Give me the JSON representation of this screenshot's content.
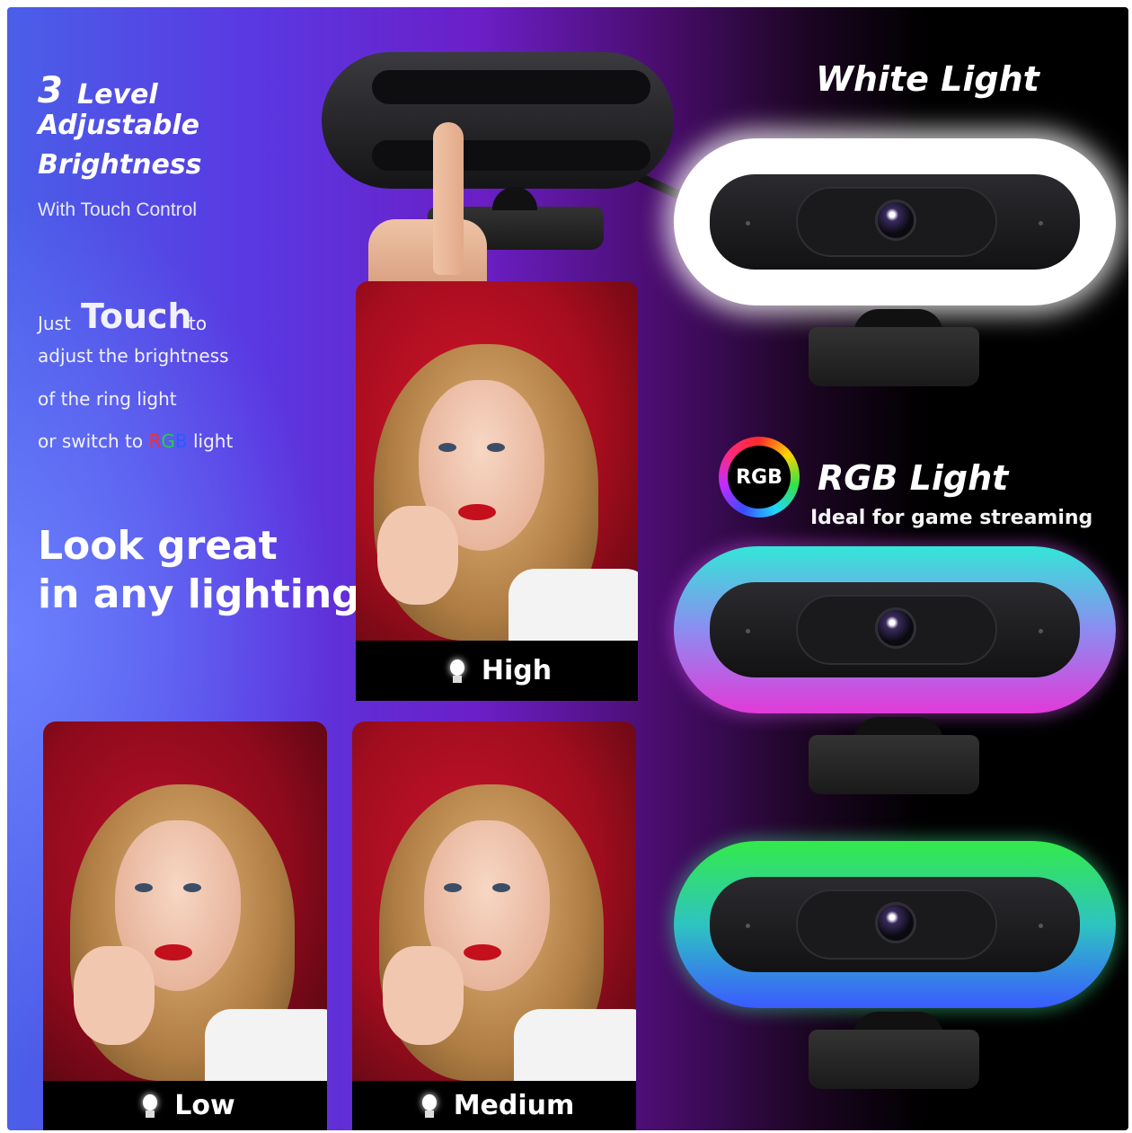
{
  "left_panel": {
    "heading_number": "3",
    "heading_level": "Level",
    "heading_adjustable": "Adjustable",
    "heading_brightness": "Brightness",
    "subtitle": "With Touch Control",
    "just": "Just",
    "touch": "Touch",
    "to": "to",
    "line2": "adjust the brightness",
    "line3": "of the ring light",
    "line4_prefix": "or switch to",
    "line4_r": "R",
    "line4_g": "G",
    "line4_b": "B",
    "line4_suffix": "light",
    "tagline_1": "Look great",
    "tagline_2": "in any lighting"
  },
  "brightness_levels": {
    "high": "High",
    "low": "Low",
    "medium": "Medium"
  },
  "right_panel": {
    "white_title": "White Light",
    "rgb_badge": "RGB",
    "rgb_title": "RGB Light",
    "rgb_subtitle": "Ideal for game streaming"
  },
  "colors": {
    "background_left": "#4a5fe8",
    "background_mid": "#6b1fc7",
    "background_right": "#000000",
    "photo_red": "#c8102e",
    "ring_white": "#ffffff",
    "ring_rgb_1_top": "#33e6d8",
    "ring_rgb_1_bottom": "#e23ad8",
    "ring_rgb_2_top": "#33ea4a",
    "ring_rgb_2_bottom": "#3a5bff"
  },
  "icons": [
    "bulb-icon",
    "rgb-ring-icon"
  ]
}
